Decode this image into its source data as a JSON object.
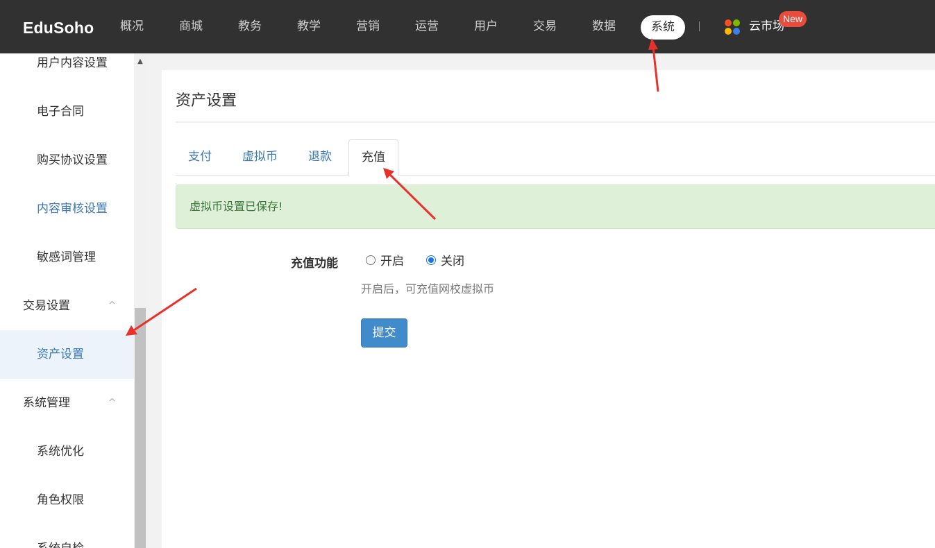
{
  "brand": "EduSoho",
  "nav": [
    {
      "label": "概况"
    },
    {
      "label": "商城"
    },
    {
      "label": "教务"
    },
    {
      "label": "教学"
    },
    {
      "label": "营销"
    },
    {
      "label": "运营"
    },
    {
      "label": "用户"
    },
    {
      "label": "交易"
    },
    {
      "label": "数据"
    },
    {
      "label": "系统",
      "active": true
    }
  ],
  "market": {
    "label": "云市场",
    "badge": "New",
    "icon": "market-grid-icon"
  },
  "sidebar": {
    "items": [
      {
        "label": "用户内容设置",
        "kind": "sub"
      },
      {
        "label": "电子合同",
        "kind": "sub"
      },
      {
        "label": "购买协议设置",
        "kind": "sub"
      },
      {
        "label": "内容审核设置",
        "kind": "sub",
        "state": "link"
      },
      {
        "label": "敏感词管理",
        "kind": "sub"
      },
      {
        "label": "交易设置",
        "kind": "group",
        "chevron": "^"
      },
      {
        "label": "资产设置",
        "kind": "sub",
        "state": "active"
      },
      {
        "label": "系统管理",
        "kind": "group",
        "chevron": "^"
      },
      {
        "label": "系统优化",
        "kind": "sub"
      },
      {
        "label": "角色权限",
        "kind": "sub"
      },
      {
        "label": "系统自检",
        "kind": "sub"
      }
    ]
  },
  "page": {
    "title": "资产设置",
    "tabs": [
      {
        "label": "支付"
      },
      {
        "label": "虚拟币"
      },
      {
        "label": "退款"
      },
      {
        "label": "充值",
        "active": true
      }
    ],
    "alert": "虚拟币设置已保存!",
    "form": {
      "label": "充值功能",
      "options": [
        {
          "label": "开启",
          "checked": false
        },
        {
          "label": "关闭",
          "checked": true
        }
      ],
      "help": "开启后，可充值网校虚拟币",
      "submit_label": "提交"
    }
  },
  "colors": {
    "topbar": "#313131",
    "link": "#3b79b8",
    "alert_bg": "#dff0d8",
    "alert_text": "#3c763d",
    "primary": "#428bca",
    "badge": "#e74c3c",
    "annotation": "#e8312a"
  }
}
